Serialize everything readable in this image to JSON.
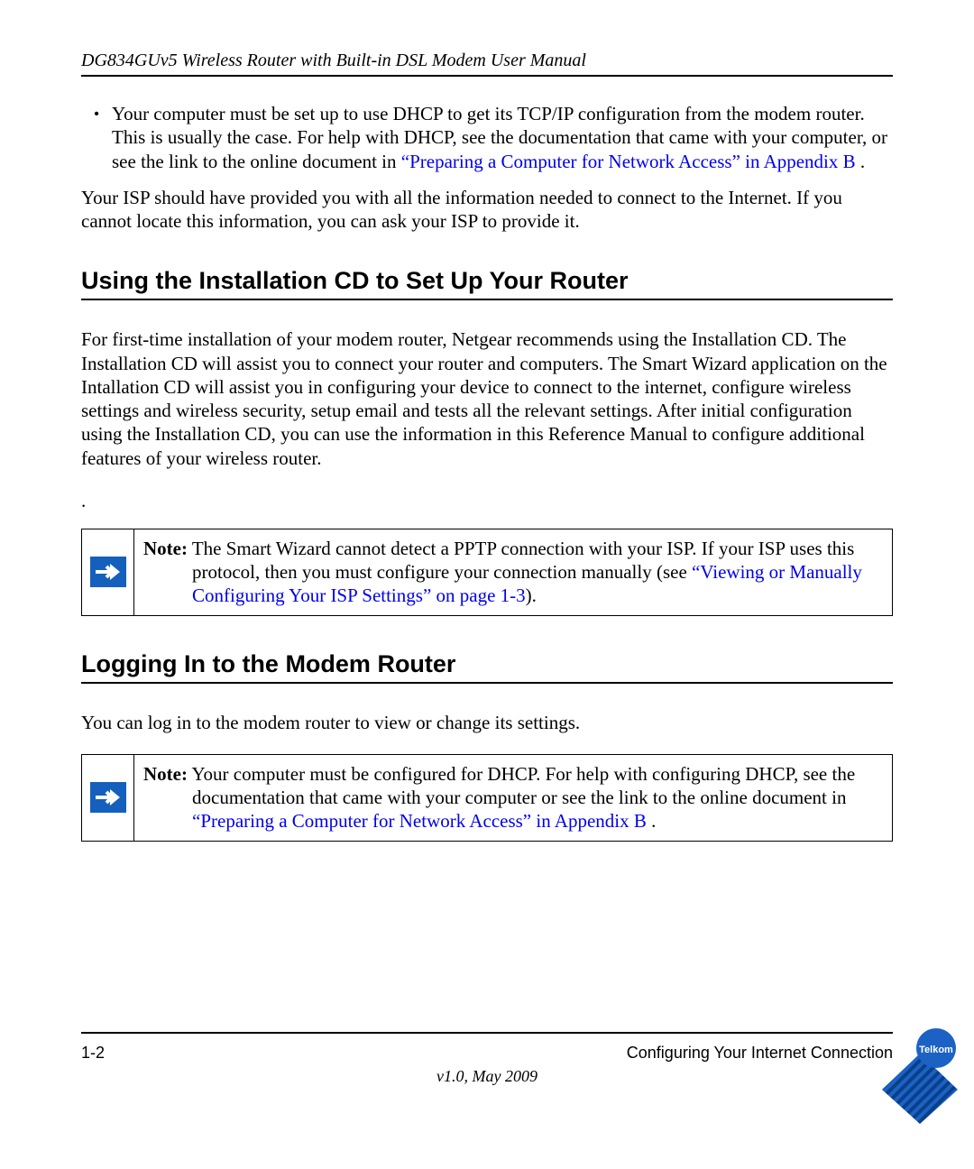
{
  "header": "DG834GUv5 Wireless Router with Built-in DSL Modem User Manual",
  "bullet": {
    "pre": "Your computer must be set up to use DHCP to get its TCP/IP configuration from the modem router. This is usually the case. For help with DHCP, see the documentation that came with your computer, or see the link to the online document in ",
    "link": "“Preparing a Computer for Network Access” in Appendix B",
    "post": " ."
  },
  "isp_para": "Your ISP should have provided you with all the information needed to connect to the Internet. If you cannot locate this information, you can ask your ISP to provide it.",
  "heading1": "Using the Installation CD to Set Up Your Router",
  "para_cd": "For first-time installation of your modem router, Netgear recommends using the Installation CD. The Installation CD will assist you to connect your router and computers. The Smart Wizard application on the Intallation CD will assist you in configuring your device to connect to the internet, configure wireless settings and wireless security, setup email and tests all the relevant settings. After initial configuration using the Installation CD, you can use the information in this Reference Manual to configure additional features of your wireless router.",
  "dot": ".",
  "note1": {
    "label": "Note:",
    "pre": " The Smart Wizard cannot detect a PPTP connection with your ISP. If your ISP uses this protocol, then you must configure your connection manually (see ",
    "link": "“Viewing or Manually Configuring Your ISP Settings” on page 1-3",
    "post": ")."
  },
  "heading2": "Logging In to the Modem Router",
  "para_login": "You can log in to the modem router to view or change its settings.",
  "note2": {
    "label": "Note:",
    "pre": " Your computer must be configured for DHCP. For help with configuring DHCP, see the documentation that came with your computer or see the link to the online document in ",
    "link": "“Preparing a Computer for Network Access” in Appendix B",
    "post": " ."
  },
  "footer": {
    "page": "1-2",
    "section": "Configuring Your Internet Connection",
    "version": "v1.0, May 2009"
  },
  "logo_name": "Telkom"
}
